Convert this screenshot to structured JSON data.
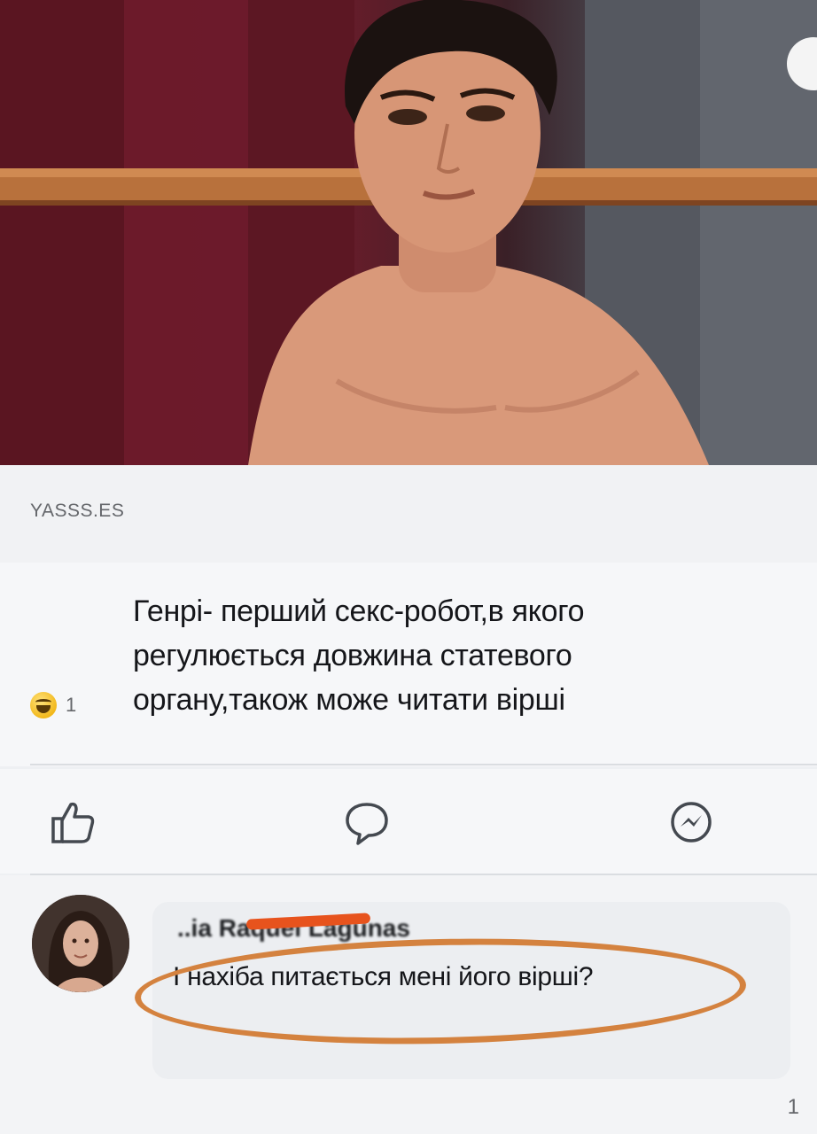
{
  "post": {
    "link_source": "YASSS.ES",
    "caption": "Генрі- перший  секс-робот,в якого\nрегулюється довжина статевого\nоргану,також може читати вірші",
    "reactions": {
      "icon": "haha-icon",
      "count": "1"
    }
  },
  "actions": [
    {
      "icon": "like-icon"
    },
    {
      "icon": "comment-icon"
    },
    {
      "icon": "messenger-icon"
    }
  ],
  "comment": {
    "author": "..ia Raquel Lagunas",
    "text": "І нахіба питається мені його вірші?"
  },
  "page_counter": "1",
  "colors": {
    "highlight": "#d4823f",
    "redaction": "#e7531d"
  }
}
